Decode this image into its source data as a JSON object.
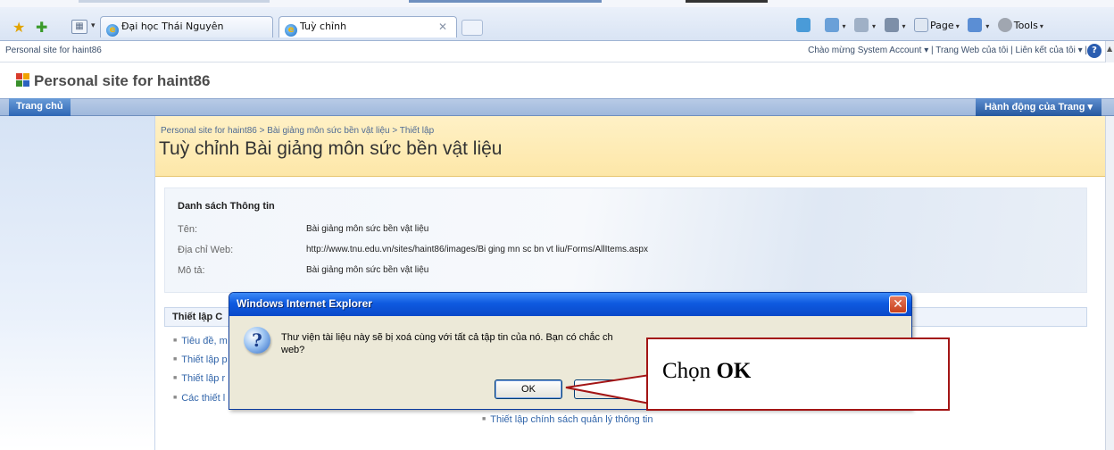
{
  "browser": {
    "tabs": [
      {
        "label": "Đại học Thái Nguyên"
      },
      {
        "label": "Tuỳ chỉnh"
      }
    ],
    "commands": {
      "page": "Page",
      "tools": "Tools"
    }
  },
  "global_nav": {
    "site_path": "Personal site for haint86",
    "welcome": "Chào mừng System Account ▾",
    "my_site": "Trang Web của tôi",
    "my_links": "Liên kết của tôi ▾"
  },
  "site": {
    "title": "Personal site for haint86"
  },
  "top_nav": {
    "home": "Trang chủ",
    "site_actions": "Hành động của Trang ▾"
  },
  "breadcrumb": "Personal site for haint86 > Bài giảng môn sức bền vật liệu > Thiết lập",
  "page_title": "Tuỳ chỉnh Bài giảng môn sức bền vật liệu",
  "list_info": {
    "heading": "Danh sách Thông tin",
    "rows": [
      {
        "label": "Tên:",
        "value": "Bài giảng môn sức bền vật liệu"
      },
      {
        "label": "Địa chỉ Web:",
        "value": "http://www.tnu.edu.vn/sites/haint86/images/Bi ging mn sc bn vt liu/Forms/AllItems.aspx"
      },
      {
        "label": "Mô tả:",
        "value": "Bài giảng môn sức bền vật liệu"
      }
    ]
  },
  "general_settings": {
    "heading": "Thiết lập C",
    "links": [
      "Tiêu đề, m",
      "Thiết lập p",
      "Thiết lập r",
      "Các thiết l"
    ],
    "permissions_link": "Thiết lập chính sách quản lý thông tin"
  },
  "dialog": {
    "title": "Windows Internet Explorer",
    "message_line1": "Thư viện tài liệu này sẽ bị xoá cùng với tất cả tập tin của nó.  Bạn có chắc ch",
    "message_line2": "web?",
    "ok_label": "OK",
    "cancel_label": ""
  },
  "callout": {
    "prefix": "Chọn ",
    "emphasis": "OK"
  },
  "colors": {
    "callout_border": "#a31515",
    "dialog_title": "#0e5ae0",
    "ribbon": "#fde7a8"
  }
}
